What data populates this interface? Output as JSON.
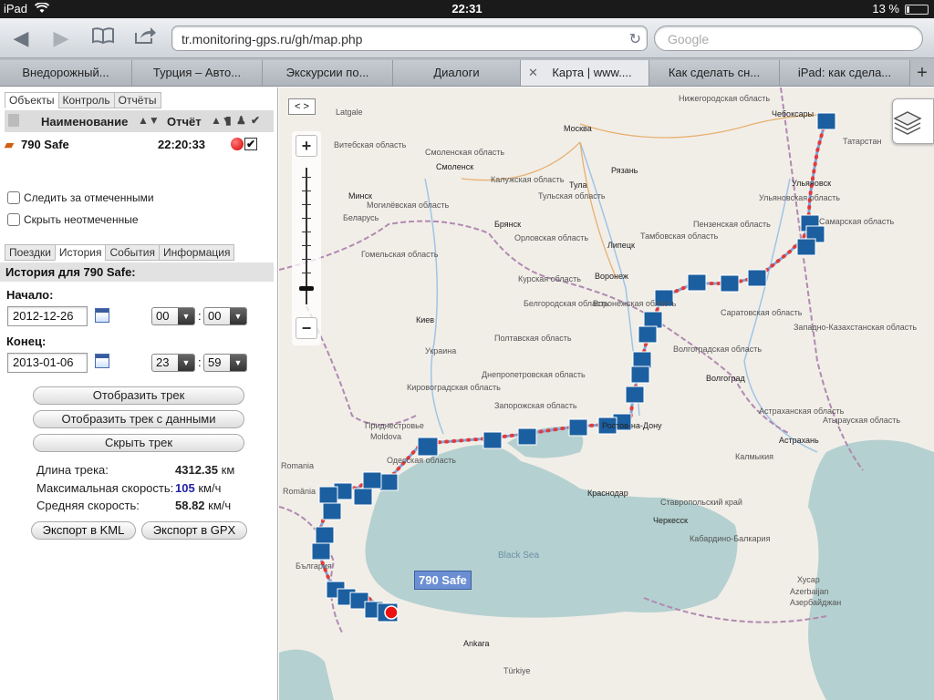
{
  "status": {
    "device": "iPad",
    "time": "22:31",
    "battery": "13 %"
  },
  "browser": {
    "url": "tr.monitoring-gps.ru/gh/map.php",
    "search_placeholder": "Google",
    "tabs": [
      "Внедорожный...",
      "Турция – Авто...",
      "Экскурсии по...",
      "Диалоги",
      "Карта | www....",
      "Как сделать сн...",
      "iPad: как сделa..."
    ],
    "active_tab": 4
  },
  "panel": {
    "top_tabs": [
      "Объекты",
      "Контроль",
      "Отчёты"
    ],
    "table": {
      "col_name": "Наименование",
      "col_report": "Отчёт"
    },
    "object": {
      "name": "790 Safe",
      "time": "22:20:33"
    },
    "follow_label": "Следить за отмеченными",
    "hide_label": "Скрыть неотмеченные",
    "tabs2": [
      "Поездки",
      "История",
      "События",
      "Информация"
    ],
    "history_title": "История для 790 Safe:",
    "start_label": "Начало:",
    "start_date": "2012-12-26",
    "start_hour": "00",
    "start_min": "00",
    "end_label": "Конец:",
    "end_date": "2013-01-06",
    "end_hour": "23",
    "end_min": "59",
    "btn_show": "Отобразить трек",
    "btn_show_data": "Отобразить трек с данными",
    "btn_hide": "Скрыть трек",
    "stats": {
      "length_label": "Длина трека:",
      "length_val": "4312.35",
      "length_unit": "км",
      "maxspeed_label": "Максимальная скорость:",
      "maxspeed_val": "105",
      "maxspeed_unit": "км/ч",
      "avgspeed_label": "Средняя скорость:",
      "avgspeed_val": "58.82",
      "avgspeed_unit": "км/ч"
    },
    "export_kml": "Экспорт в KML",
    "export_gpx": "Экспорт в GPX"
  },
  "map": {
    "toggle": "< >",
    "vehicle_label": "790 Safe",
    "places": [
      "Нижегородская область",
      "Чебоксары",
      "Татарстан",
      "Москва",
      "Смоленск",
      "Смоленская область",
      "Калужская область",
      "Рязань",
      "Тульская область",
      "Тула",
      "Ульяновск",
      "Ульяновская область",
      "Самарская область",
      "Пензенская область",
      "Брянск",
      "Орловская область",
      "Липецк",
      "Тамбовская область",
      "Воронеж",
      "Курская область",
      "Белгородская область",
      "Воронежская область",
      "Саратовская область",
      "Волгоградская область",
      "Волгоград",
      "Западно-Казахстанская область",
      "Киев",
      "Украина",
      "Днепропетровская область",
      "Кировоградская область",
      "Запорожская область",
      "Ростов-на-Дону",
      "Астраханская область",
      "Атырауская область",
      "Астрахань",
      "Краснодар",
      "Калмыкия",
      "Ставропольский край",
      "Черкесск",
      "Кабардино-Балкария",
      "Moldova",
      "Приднестровье",
      "Одесская область",
      "Romania",
      "România",
      "Latgale",
      "Витебская область",
      "Минск",
      "Беларусь",
      "Гомельская область",
      "Могилёвская область",
      "Полтавская область",
      "Ankara",
      "Türkiye",
      "Azerbaijan",
      "Хусар",
      "Азербайджан",
      "България",
      "Black Sea"
    ]
  }
}
